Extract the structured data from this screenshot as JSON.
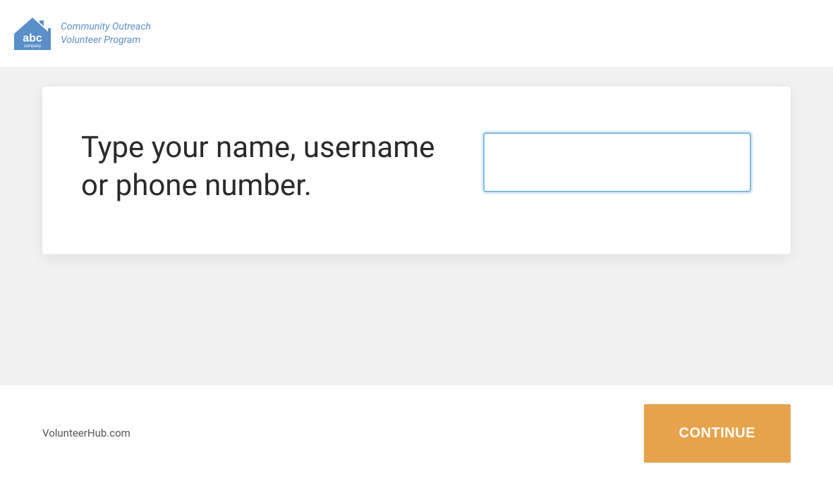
{
  "header": {
    "logo_company": "abc company",
    "tagline_line1": "Community Outreach",
    "tagline_line2": "Volunteer Program"
  },
  "main": {
    "prompt": "Type your name, username or phone number.",
    "input_value": ""
  },
  "footer": {
    "brand": "VolunteerHub.com",
    "continue_label": "CONTINUE"
  },
  "colors": {
    "accent_blue": "#5a8fc9",
    "button_orange": "#e6a34b",
    "input_border": "#9ec9ed",
    "bg_gray": "#f1f1f1"
  }
}
